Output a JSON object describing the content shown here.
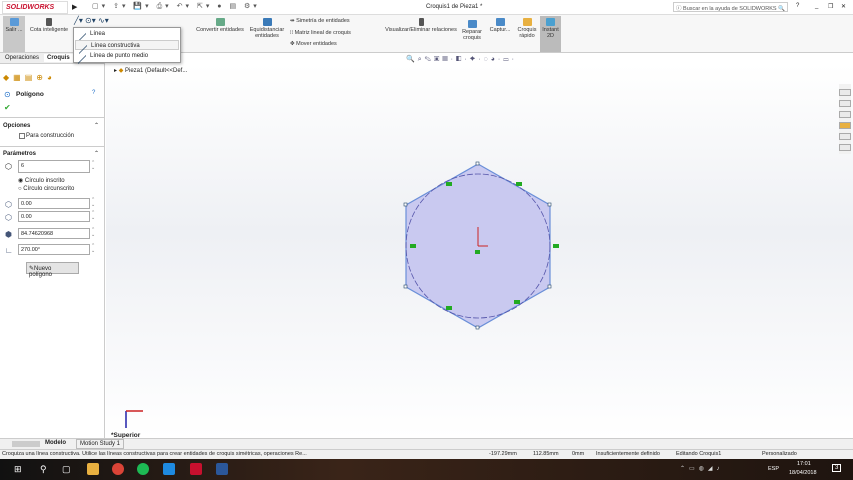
{
  "app": {
    "brand": "SOLIDWORKS",
    "title": "Croquis1 de Pieza1 *",
    "search_placeholder": "Buscar en la ayuda de SOLIDWORKS",
    "help": "?",
    "minimize": "_",
    "restore": "❐",
    "close": "✕"
  },
  "ribbon": {
    "exit": "Salir ...",
    "smart_dim": "Cota inteligente",
    "convert": "Convertir entidades",
    "offset": "Equidistanciar entidades",
    "mirror": "Simetría de entidades",
    "linear_pattern": "Matriz lineal de croquis",
    "move": "Mover entidades",
    "relations": "Visualizar/Eliminar relaciones",
    "repair": "Reparar croquis",
    "capture": "Captur...",
    "quick_sketch": "Croquis rápido",
    "instant2d": "Instant 2D",
    "trim_partial": "des"
  },
  "dropdown": {
    "items": [
      "Línea",
      "Línea constructiva",
      "Línea de punto medio"
    ]
  },
  "tabs": [
    "Operaciones",
    "Croquis"
  ],
  "tree": {
    "root": "Pieza1  (Default<<Def..."
  },
  "panel": {
    "title": "Polígono",
    "options_header": "Opciones",
    "for_construction": "Para construcción",
    "params_header": "Parámetros",
    "sides": "6",
    "inscribed": "Círculo inscrito",
    "circumscribed": "Círculo circunscrito",
    "x": "0.00",
    "y": "0.00",
    "diameter": "84.74620968",
    "angle": "270.00°",
    "new_polygon": "Nuevo polígono",
    "inscribed_selected": true,
    "construction_checked": false
  },
  "view": {
    "orientation": "*Superior"
  },
  "bottom_tabs": [
    "Modelo",
    "Motion Study 1"
  ],
  "status": {
    "message": "Croquiza una línea constructiva. Utilice las líneas constructivas para crear entidades de croquis simétricas, operaciones Re...",
    "x": "-197.29mm",
    "y": "112.85mm",
    "z": "0mm",
    "state": "Insuficientemente definido",
    "editing": "Editando Croquis1",
    "units": "Personalizado"
  },
  "taskbar": {
    "lang": "ESP",
    "time": "17:01",
    "date": "18/04/2018",
    "notifications": "3"
  },
  "colors": {
    "accent": "#1e6ec8",
    "sketch": "#6a8fd8",
    "fill": "#c9c9f0",
    "brand": "#c8102e"
  }
}
